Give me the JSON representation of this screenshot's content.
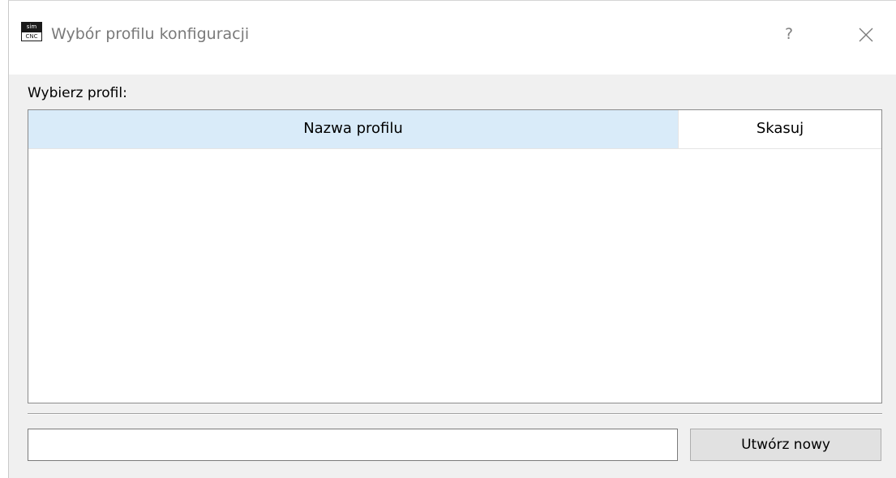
{
  "window": {
    "title": "Wybór profilu konfiguracji",
    "icon_text_top": "sim",
    "icon_text_bottom": "CNC",
    "help_label": "?",
    "close_icon": "close-icon"
  },
  "main": {
    "prompt": "Wybierz profil:",
    "table": {
      "columns": [
        "Nazwa profilu",
        "Skasuj"
      ],
      "rows": []
    },
    "new_profile_input": {
      "value": "",
      "placeholder": ""
    },
    "create_button_label": "Utwórz nowy"
  },
  "colors": {
    "header_selected": "#d9ebf9",
    "dialog_bg": "#f0f0f0",
    "title_text": "#7a7a7a"
  }
}
